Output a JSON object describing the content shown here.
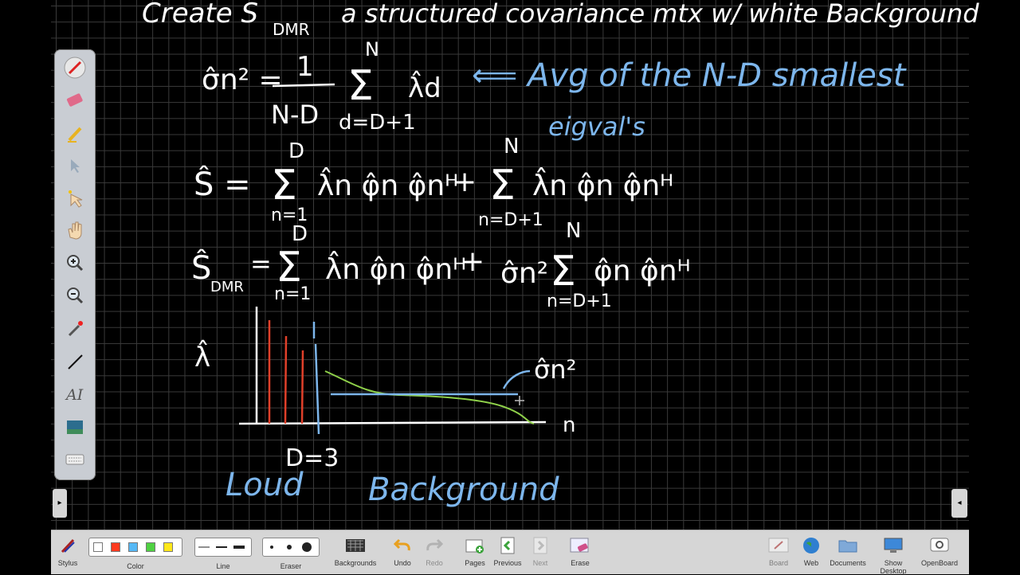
{
  "board": {
    "title_line": "Create S",
    "title_sub": "DMR",
    "title_rest": "a structured covariance mtx w/ white Background",
    "eq1": {
      "lhs": "σ̂n² =",
      "frac_num": "1",
      "frac_den": "N-D",
      "sum_top": "N",
      "sum_bottom": "d=D+1",
      "term": "λ̂d",
      "note_arrow": "⟸ Avg of the N-D smallest",
      "note_sub": "eigval's"
    },
    "eq2": {
      "lhs": "Ŝ =",
      "sum1_top": "D",
      "sum1_bottom": "n=1",
      "term1": "λ̂n φ̂n φ̂nᴴ",
      "plus": "+",
      "sum2_top": "N",
      "sum2_bottom": "n=D+1",
      "term2": "λ̂n φ̂n φ̂nᴴ"
    },
    "eq3": {
      "lhs": "Ŝ",
      "lhs_sub": "DMR",
      "eq": "=",
      "sum1_top": "D",
      "sum1_bottom": "n=1",
      "term1": "λ̂n φ̂n φ̂nᴴ",
      "plus": "+",
      "coef": "σ̂n²",
      "sum2_top": "N",
      "sum2_bottom": "n=D+1",
      "term2": "φ̂n φ̂nᴴ"
    },
    "graph": {
      "y_label": "λ̂",
      "x_label": "n",
      "d_label": "D=3",
      "sigma_label": "σ̂n²",
      "loud_label": "Loud",
      "background_label": "Background"
    }
  },
  "palette": {
    "tools": [
      "pen-icon",
      "eraser-icon",
      "marker-icon",
      "selector-icon",
      "play-icon",
      "hand-icon",
      "zoom-in-icon",
      "zoom-out-icon",
      "laser-pointer-icon",
      "line-icon",
      "text-icon",
      "capture-icon",
      "virtual-keyboard-icon"
    ]
  },
  "toolbar": {
    "stylus": "Stylus",
    "color": "Color",
    "line": "Line",
    "eraser": "Eraser",
    "backgrounds": "Backgrounds",
    "undo": "Undo",
    "redo": "Redo",
    "pages": "Pages",
    "previous": "Previous",
    "next": "Next",
    "erase": "Erase",
    "board": "Board",
    "web": "Web",
    "documents": "Documents",
    "show_desktop": "Show Desktop",
    "openboard": "OpenBoard",
    "colors": [
      "#ffffff",
      "#ff3b1f",
      "#56b8f5",
      "#4fd142",
      "#ffe81a"
    ]
  }
}
